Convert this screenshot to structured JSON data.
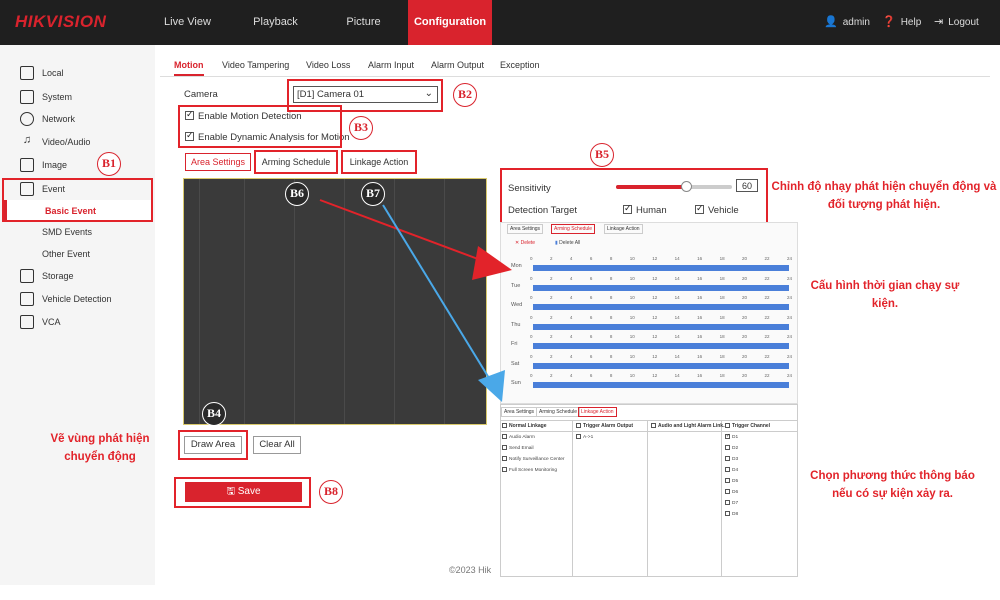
{
  "header": {
    "logo": "HIKVISION",
    "nav": [
      "Live View",
      "Playback",
      "Picture",
      "Configuration"
    ],
    "active_nav": "Configuration",
    "user": "admin",
    "help": "Help",
    "logout": "Logout"
  },
  "sidebar": {
    "items": [
      {
        "label": "Local",
        "icon": "monitor-icon"
      },
      {
        "label": "System",
        "icon": "system-icon"
      },
      {
        "label": "Network",
        "icon": "globe-icon"
      },
      {
        "label": "Video/Audio",
        "icon": "video-audio-icon"
      },
      {
        "label": "Image",
        "icon": "image-icon"
      },
      {
        "label": "Event",
        "icon": "calendar-icon"
      },
      {
        "label": "Basic Event"
      },
      {
        "label": "SMD Events"
      },
      {
        "label": "Other Event"
      },
      {
        "label": "Storage",
        "icon": "storage-icon"
      },
      {
        "label": "Vehicle Detection",
        "icon": "vehicle-icon"
      },
      {
        "label": "VCA",
        "icon": "vca-icon"
      }
    ],
    "selected": "Basic Event"
  },
  "subtabs": [
    "Motion",
    "Video Tampering",
    "Video Loss",
    "Alarm Input",
    "Alarm Output",
    "Exception"
  ],
  "form": {
    "camera_label": "Camera",
    "camera_value": "[D1] Camera 01",
    "enable_motion": "Enable Motion Detection",
    "enable_dynamic": "Enable Dynamic Analysis for Motion",
    "tabs": [
      "Area Settings",
      "Arming Schedule",
      "Linkage Action"
    ],
    "draw_area": "Draw Area",
    "clear_all": "Clear All",
    "save": "Save",
    "footer": "©2023 Hik"
  },
  "sensitivity": {
    "label": "Sensitivity",
    "value": "60",
    "level": 0.6,
    "target_label": "Detection Target",
    "human": "Human",
    "vehicle": "Vehicle"
  },
  "schedule": {
    "tabs": [
      "Area Settings",
      "Arming Schedule",
      "Linkage Action"
    ],
    "delete": "Delete",
    "delete_all": "Delete All",
    "days": [
      "Mon",
      "Tue",
      "Wed",
      "Thu",
      "Fri",
      "Sat",
      "Sun"
    ],
    "hours": [
      "0",
      "2",
      "4",
      "6",
      "8",
      "10",
      "12",
      "14",
      "16",
      "18",
      "20",
      "22",
      "24"
    ]
  },
  "linkage": {
    "tabs": [
      "Area Settings",
      "Arming Schedule",
      "Linkage Action"
    ],
    "headers": [
      "Normal Linkage",
      "Trigger Alarm Output",
      "Audio and Light Alarm Link...",
      "Trigger Channel"
    ],
    "normal": [
      "Audio Alarm",
      "Send Email",
      "Notify Surveillance Center",
      "Full Screen Monitoring"
    ],
    "alarm_output": [
      "A->1"
    ],
    "channels": [
      "D1",
      "D2",
      "D3",
      "D4",
      "D5",
      "D6",
      "D7",
      "D8"
    ]
  },
  "badges": [
    "B1",
    "B2",
    "B3",
    "B4",
    "B5",
    "B6",
    "B7",
    "B8"
  ],
  "annotations": {
    "b4": "Vẽ vùng phát hiện chuyển động",
    "b5": "Chỉnh độ nhạy phát hiện chuyển động và đối tượng phát hiện.",
    "b6": "Cấu hình thời gian chạy sự kiện.",
    "b7": "Chọn phương thức thông báo nếu có sự kiện xảy ra."
  },
  "colors": {
    "accent": "#d9232d",
    "schedule_bar": "#4a7fd9",
    "arrow_blue": "#4aa8e8"
  }
}
